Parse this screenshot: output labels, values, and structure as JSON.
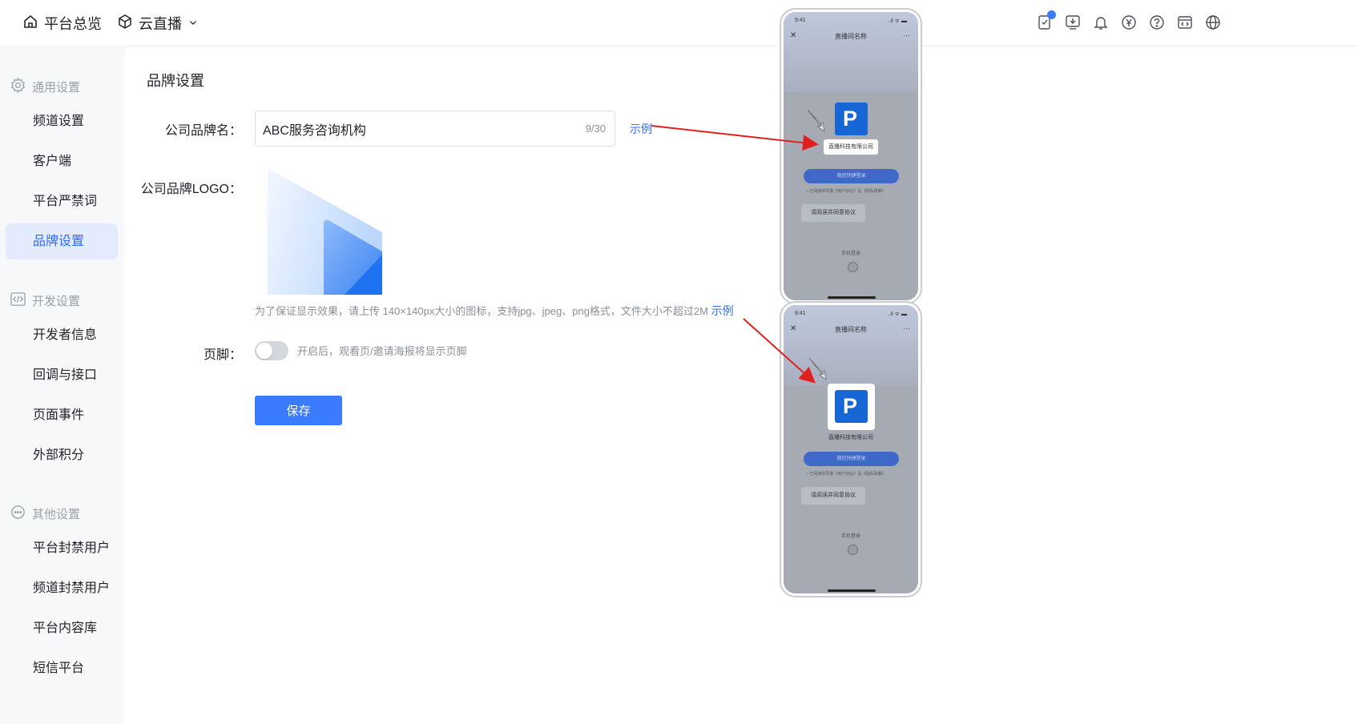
{
  "header": {
    "nav": [
      {
        "label": "平台总览",
        "icon": "home-icon"
      },
      {
        "label": "云直播",
        "icon": "cube-icon",
        "dropdown": true
      }
    ],
    "icons": [
      "task-icon",
      "download-icon",
      "bell-icon",
      "yen-icon",
      "help-icon",
      "code-window-icon",
      "globe-icon"
    ]
  },
  "sidebar": {
    "groups": [
      {
        "title": "通用设置",
        "icon": "gear-icon",
        "items": [
          "频道设置",
          "客户端",
          "平台严禁词",
          "品牌设置"
        ]
      },
      {
        "title": "开发设置",
        "icon": "code-icon",
        "items": [
          "开发者信息",
          "回调与接口",
          "页面事件",
          "外部积分"
        ]
      },
      {
        "title": "其他设置",
        "icon": "more-icon",
        "items": [
          "平台封禁用户",
          "频道封禁用户",
          "平台内容库",
          "短信平台"
        ]
      }
    ],
    "active_item": "品牌设置"
  },
  "main": {
    "title": "品牌设置",
    "brand_name_label": "公司品牌名：",
    "brand_name_value": "ABC服务咨询机构",
    "brand_name_count": "9/30",
    "example_link": "示例",
    "logo_label": "公司品牌LOGO：",
    "logo_hint": "为了保证显示效果，请上传 140×140px大小的图标，支持jpg、jpeg、png格式，文件大小不超过2M",
    "footer_label": "页脚：",
    "footer_enabled": false,
    "footer_desc": "开启后，观看页/邀请海报将显示页脚",
    "save_label": "保存"
  },
  "previews": {
    "status_time": "9:41",
    "status_right": "..ıl ᯤ ▬",
    "room_title": "直播间名称",
    "close_glyph": "✕",
    "more_glyph": "···",
    "logo_letter": "P",
    "company_name": "直播科技有限公司",
    "login_button": "微信快捷登录",
    "agreement": "○ 已阅读并同意《用户协议》及《隐私政策》",
    "agree_tip": "请阅读并同意协议",
    "phone_login": "手机登录"
  },
  "colors": {
    "accent": "#3a7bff",
    "active_bg": "#e3ebfc",
    "arrow": "#e02020"
  }
}
